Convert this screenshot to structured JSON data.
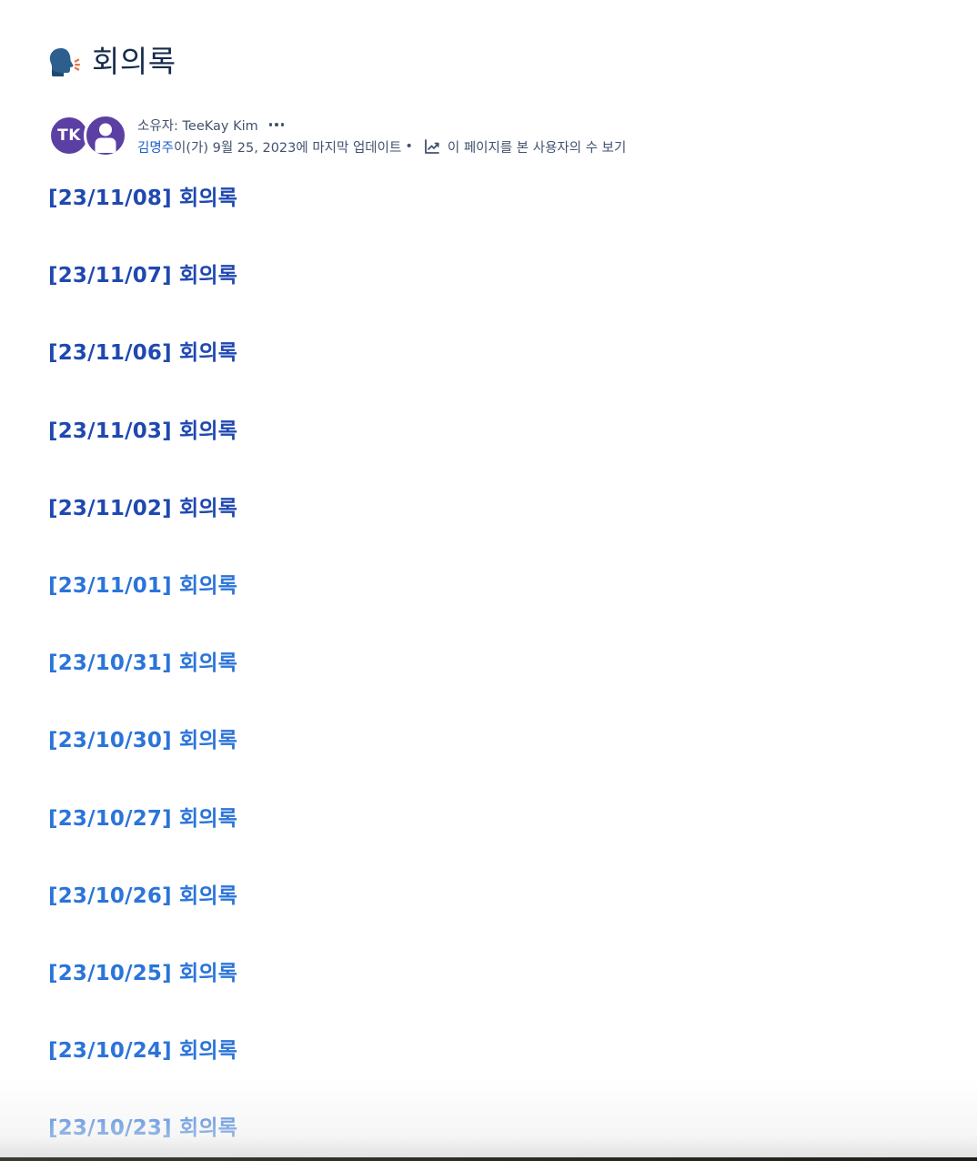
{
  "page": {
    "title": "회의록",
    "title_icon": "speaking-head-emoji"
  },
  "byline": {
    "owner_text": "소유자: TeeKay Kim",
    "owner_avatar_initials": "TK",
    "editor_name": "김명주",
    "updated_text": "이(가) 9월 25, 2023에 마지막 업데이트",
    "separator": "•",
    "analytics_label": "이 페이지를 본 사용자의 수 보기",
    "analytics_icon": "chart-trend-icon",
    "more_icon": "more-horizontal-icon"
  },
  "links": [
    {
      "label": "[23/11/08] 회의록",
      "visited": true
    },
    {
      "label": "[23/11/07] 회의록",
      "visited": true
    },
    {
      "label": "[23/11/06] 회의록",
      "visited": true
    },
    {
      "label": "[23/11/03] 회의록",
      "visited": true
    },
    {
      "label": "[23/11/02] 회의록",
      "visited": true
    },
    {
      "label": "[23/11/01] 회의록",
      "visited": false
    },
    {
      "label": "[23/10/31] 회의록",
      "visited": false
    },
    {
      "label": "[23/10/30] 회의록",
      "visited": false
    },
    {
      "label": "[23/10/27] 회의록",
      "visited": false
    },
    {
      "label": "[23/10/26] 회의록",
      "visited": false
    },
    {
      "label": "[23/10/25] 회의록",
      "visited": false
    },
    {
      "label": "[23/10/24] 회의록",
      "visited": false
    },
    {
      "label": "[23/10/23] 회의록",
      "visited": false
    }
  ],
  "colors": {
    "visited_link": "#1f48b0",
    "unvisited_link": "#2b74d9",
    "avatar_bg": "#5b3fa3",
    "text": "#172b4d"
  }
}
